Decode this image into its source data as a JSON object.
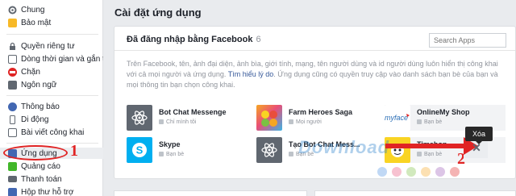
{
  "sidebar": {
    "items": [
      {
        "label": "Chung",
        "icon": "gear-icon",
        "color": "#606770"
      },
      {
        "label": "Bảo mật",
        "icon": "badge-icon",
        "color": "#f7b928"
      },
      {
        "label": "Quyền riêng tư",
        "icon": "lock-icon",
        "color": "#606770"
      },
      {
        "label": "Dòng thời gian và gắn t...",
        "icon": "timeline-icon",
        "color": "#606770"
      },
      {
        "label": "Chặn",
        "icon": "block-icon",
        "color": "#e02424"
      },
      {
        "label": "Ngôn ngữ",
        "icon": "language-icon",
        "color": "#606770"
      },
      {
        "label": "Thông báo",
        "icon": "globe-icon",
        "color": "#4267b2"
      },
      {
        "label": "Di động",
        "icon": "mobile-icon",
        "color": "#606770"
      },
      {
        "label": "Bài viết công khai",
        "icon": "rss-icon",
        "color": "#606770"
      },
      {
        "label": "Ứng dụng",
        "icon": "apps-icon",
        "color": "#4267b2"
      },
      {
        "label": "Quảng cáo",
        "icon": "ads-icon",
        "color": "#42b72a"
      },
      {
        "label": "Thanh toán",
        "icon": "card-icon",
        "color": "#606770"
      },
      {
        "label": "Hộp thư hỗ trợ",
        "icon": "support-icon",
        "color": "#4267b2"
      }
    ]
  },
  "main": {
    "title": "Cài đặt ứng dụng",
    "panel": {
      "title": "Đã đăng nhập bằng Facebook",
      "count": "6",
      "search_placeholder": "Search Apps",
      "description": "Trên Facebook, tên, ảnh đại diện, ảnh bìa, giới tính, mạng, tên người dùng và id người dùng luôn hiển thị công khai với cả mọi người và ứng dụng.",
      "description_link": "Tìm hiểu lý do",
      "description_tail": ". Ứng dụng cũng có quyền truy cập vào danh sách bạn bè của bạn và mọi thông tin bạn chọn công khai.",
      "apps": [
        {
          "name": "Bot Chat Messenge",
          "privacy": "Chỉ mình tôi",
          "icon": "atom-icon"
        },
        {
          "name": "Farm Heroes Saga",
          "privacy": "Mọi người",
          "icon": "farm-heroes-icon"
        },
        {
          "name": "OnlineMy Shop",
          "privacy": "Bạn bè",
          "icon": "myface-icon"
        },
        {
          "name": "Skype",
          "privacy": "Bạn bè",
          "icon": "skype-icon"
        },
        {
          "name": "Tạo Bot Chat Mess...",
          "privacy": "Bạn bè",
          "icon": "atom-icon"
        },
        {
          "name": "Timehop",
          "privacy": "Bạn bè",
          "icon": "timehop-icon"
        }
      ]
    },
    "tooltip": "Xóa"
  },
  "annotations": {
    "step1": "1",
    "step2": "2"
  },
  "watermark": {
    "logo_text": "Download"
  },
  "colors": {
    "accent": "#4267b2",
    "annotation": "#e02424",
    "link": "#365899"
  }
}
